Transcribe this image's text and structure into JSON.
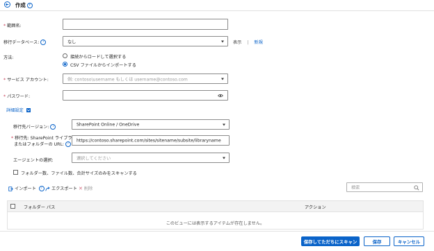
{
  "header": {
    "title": "作成"
  },
  "form": {
    "range_name": {
      "label": "範囲名:",
      "value": ""
    },
    "migration_db": {
      "label": "移行データベース:",
      "value": "なし",
      "show_link": "表示",
      "separator": "|",
      "new_link": "新規"
    },
    "method": {
      "label": "方法:",
      "options": [
        "接続からロードして選択する",
        "CSV ファイルからインポートする"
      ],
      "selected": 1
    },
    "service_account": {
      "label": "サービス アカウント:",
      "placeholder": "例: contoso\\username もしくは username@contoso.com"
    },
    "password": {
      "label": "パスワード:",
      "value": ""
    },
    "advanced": {
      "label": "詳細設定"
    },
    "target_version": {
      "label": "移行先バージョン:",
      "value": "SharePoint Online / OneDrive"
    },
    "target_url": {
      "label_line1": "移行先: SharePoint ライブラリ",
      "label_line2": "またはフォルダーの URL:",
      "value": "https://contoso.sharepoint.com/sites/sitename/subsite/libraryname"
    },
    "agent": {
      "label": "エージェントの選択:",
      "placeholder": "選択してください"
    },
    "scan_only": {
      "label": "フォルダー数、ファイル数、合計サイズのみをスキャンする",
      "checked": false
    }
  },
  "toolbar": {
    "import_label": "インポート",
    "export_label": "エクスポート",
    "delete_label": "削除"
  },
  "search": {
    "placeholder": "検索"
  },
  "table": {
    "columns": [
      "フォルダー パス",
      "アクション"
    ],
    "empty_message": "このビューには表示するアイテムが存在しません。"
  },
  "footer": {
    "save_scan_label": "保存してただちにスキャン",
    "save_label": "保存",
    "cancel_label": "キャンセル"
  },
  "colors": {
    "accent": "#0a63c9",
    "required": "#c4314b",
    "border": "#8a8a8a"
  }
}
